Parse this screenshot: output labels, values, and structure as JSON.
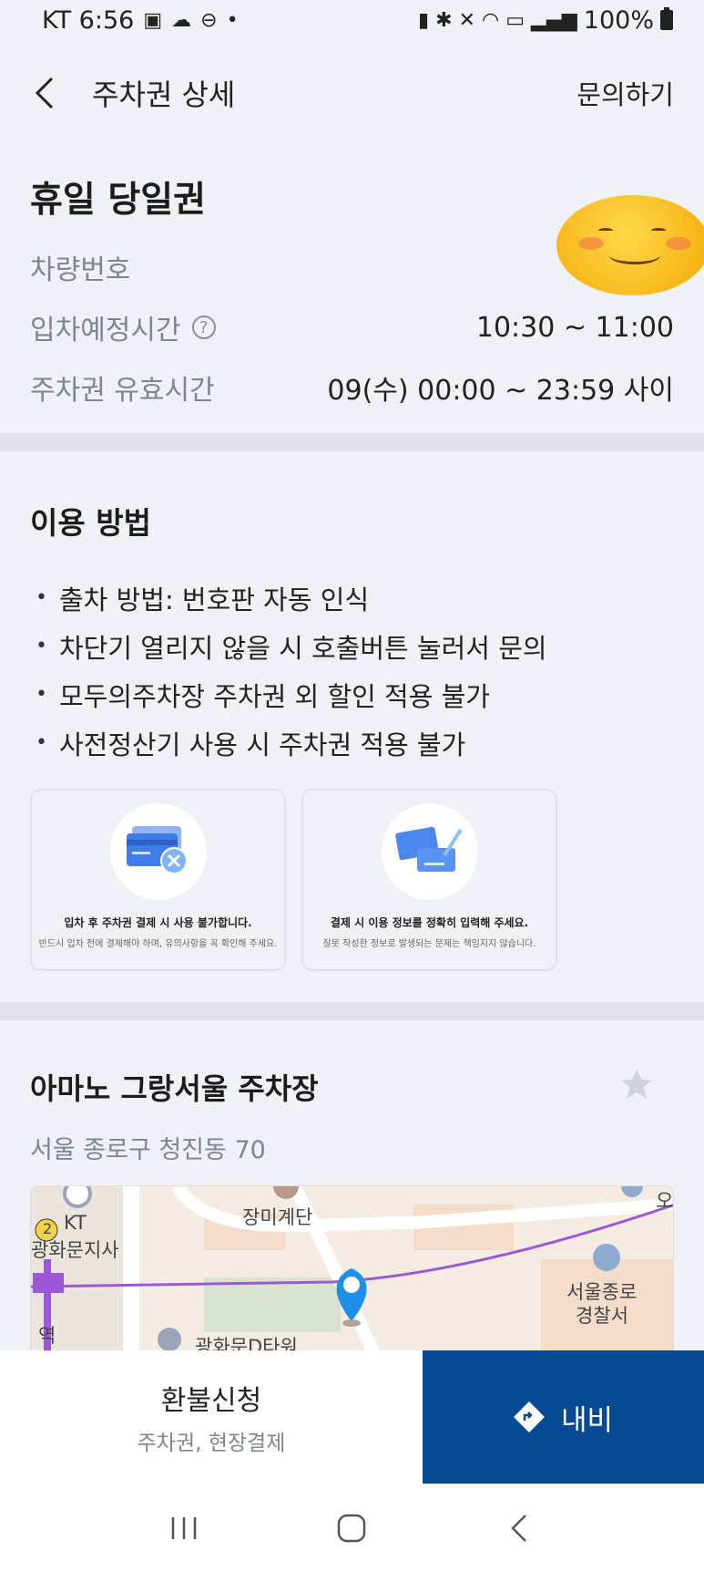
{
  "status_bar": {
    "carrier_time": "KT 6:56",
    "battery": "100%"
  },
  "header": {
    "title": "주차권 상세",
    "inquiry": "문의하기"
  },
  "ticket": {
    "name": "휴일 당일권",
    "rows": [
      {
        "label": "차량번호",
        "value": ""
      },
      {
        "label": "입차예정시간",
        "value": "10:30 ~ 11:00"
      },
      {
        "label": "주차권 유효시간",
        "value": "09(수) 00:00 ~ 23:59 사이"
      }
    ],
    "help_glyph": "?"
  },
  "usage": {
    "title": "이용 방법",
    "bullet": "•",
    "rules": [
      "출차 방법: 번호판 자동 인식",
      "차단기 열리지 않을 시 호출버튼 눌러서 문의",
      "모두의주차장 주차권 외 할인 적용 불가",
      "사전정산기 사용 시 주차권 적용 불가"
    ],
    "cards": [
      {
        "title": "입차 후 주차권 결제 시 사용 불가합니다.",
        "desc": "반드시 입차 전에 결제해야 하며, 유의사항을 꼭 확인해 주세요.",
        "icon": "card-cancel-icon"
      },
      {
        "title": "결제 시 이용 정보를 정확히 입력해 주세요.",
        "desc": "잘못 작성한 정보로 발생되는 문제는 책임지지 않습니다.",
        "icon": "info-card-pen-icon"
      }
    ]
  },
  "parking": {
    "name": "아마노 그랑서울 주차장",
    "address": "서울 종로구 청진동 70",
    "map_labels": {
      "kt": "KT",
      "kt_branch": "광화문지사",
      "stage": "장미계단",
      "police": "서울종로",
      "police2": "경찰서",
      "tower": "광화문D타워",
      "station": "역",
      "line_no": "2",
      "edge": "오"
    }
  },
  "bottom": {
    "refund_title": "환불신청",
    "refund_sub": "주차권, 현장결제",
    "navi_label": "내비"
  },
  "colors": {
    "accent_blue": "#074a93",
    "pin_blue": "#1e8fe8",
    "route_purple": "#9b59d6"
  }
}
